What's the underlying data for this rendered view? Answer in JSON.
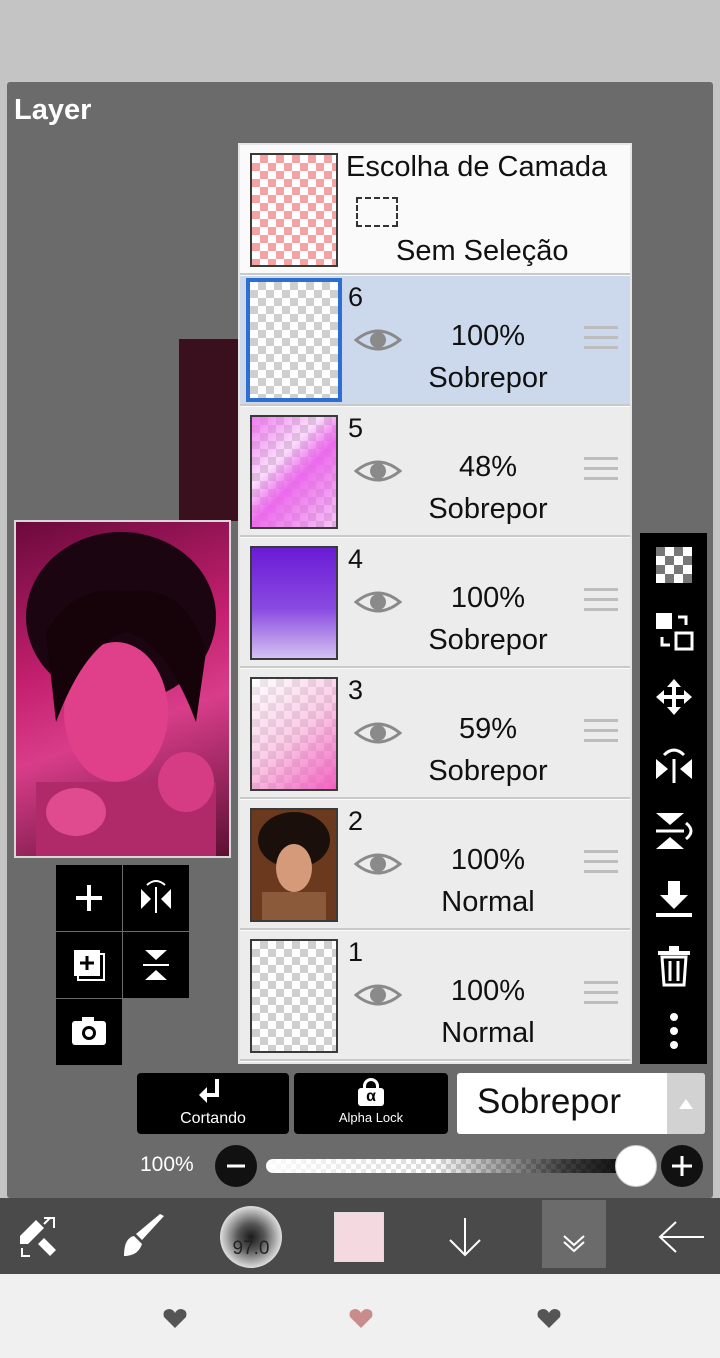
{
  "panel_title": "Layer",
  "selection_row": {
    "title": "Escolha de Camada",
    "status": "Sem Seleção"
  },
  "layers": [
    {
      "number": "6",
      "opacity": "100%",
      "blend": "Sobrepor",
      "selected": true
    },
    {
      "number": "5",
      "opacity": "48%",
      "blend": "Sobrepor",
      "selected": false
    },
    {
      "number": "4",
      "opacity": "100%",
      "blend": "Sobrepor",
      "selected": false
    },
    {
      "number": "3",
      "opacity": "59%",
      "blend": "Sobrepor",
      "selected": false
    },
    {
      "number": "2",
      "opacity": "100%",
      "blend": "Normal",
      "selected": false
    },
    {
      "number": "1",
      "opacity": "100%",
      "blend": "Normal",
      "selected": false
    }
  ],
  "blend_bar": {
    "clipping_label": "Cortando",
    "alpha_lock_label": "Alpha Lock",
    "alpha_symbol": "α",
    "blend_mode": "Sobrepor"
  },
  "opacity_bar": {
    "label": "100%",
    "value": 1.0
  },
  "toolbar": {
    "brush_size": "97.0",
    "color": "#f5d9e0"
  },
  "right_tools": [
    "checker-icon",
    "transform-copy-icon",
    "move-icon",
    "flip-horizontal-icon",
    "flip-vertical-icon",
    "merge-down-icon",
    "trash-icon",
    "more-icon"
  ],
  "left_tools": [
    "add-layer-icon",
    "flip-layer-icon",
    "add-copy-icon",
    "flip-vertical-icon",
    "camera-icon"
  ],
  "nav": [
    "heart-icon",
    "heart-icon",
    "heart-icon"
  ]
}
